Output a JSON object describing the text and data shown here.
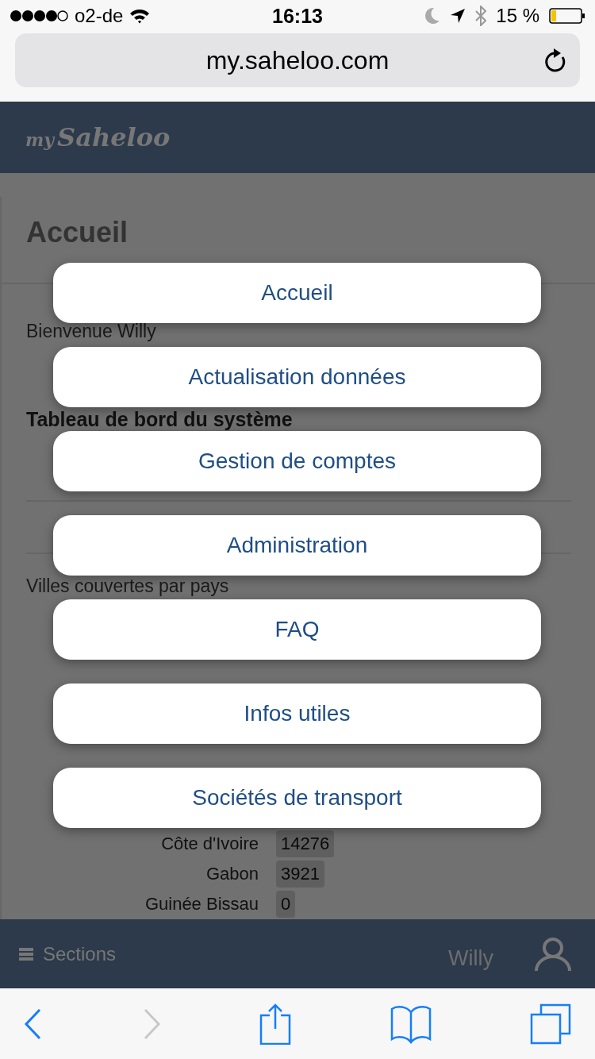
{
  "status_bar": {
    "carrier": "o2-de",
    "time": "16:13",
    "battery": "15 %"
  },
  "address_bar": {
    "url": "my.saheloo.com"
  },
  "header": {
    "logo_prefix": "my",
    "logo_name": "Saheloo"
  },
  "page": {
    "title": "Accueil",
    "welcome": "Bienvenue Willy",
    "section_title": "Tableau de bord du système",
    "chart_title": "Villes couvertes par pays",
    "rows": [
      {
        "country": "Côte d'Ivoire",
        "value": "14276"
      },
      {
        "country": "Gabon",
        "value": "3921"
      },
      {
        "country": "Guinée Bissau",
        "value": "0"
      }
    ]
  },
  "footer": {
    "menu_label": "Sections",
    "user": "Willy"
  },
  "menu": [
    {
      "label": "Accueil"
    },
    {
      "label": "Actualisation données"
    },
    {
      "label": "Gestion de comptes"
    },
    {
      "label": "Administration"
    },
    {
      "label": "FAQ"
    },
    {
      "label": "Infos utiles"
    },
    {
      "label": "Sociétés de transport"
    }
  ],
  "toolbar": [
    {
      "kind": "back",
      "disabled": false
    },
    {
      "kind": "forward",
      "disabled": true
    },
    {
      "kind": "share",
      "disabled": false
    },
    {
      "kind": "bookmarks",
      "disabled": false
    },
    {
      "kind": "tabs",
      "disabled": false
    }
  ]
}
